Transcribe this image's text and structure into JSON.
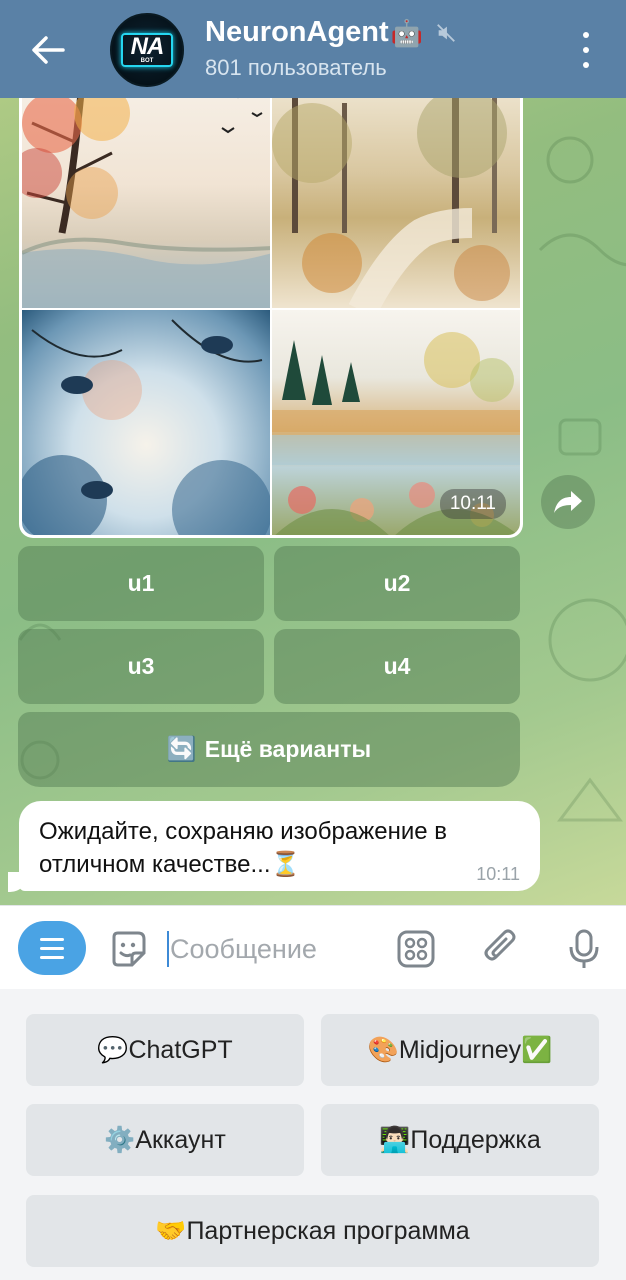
{
  "header": {
    "title": "NeuronAgent",
    "subtitle": "801 пользователь",
    "avatar_text": "NA",
    "avatar_subtext": "BOT",
    "title_emoji": "🤖"
  },
  "image_message": {
    "time": "10:11"
  },
  "inline_buttons": {
    "u1": "u1",
    "u2": "u2",
    "u3": "u3",
    "u4": "u4",
    "more_emoji": "🔄",
    "more_label": "Ещё варианты"
  },
  "text_message": {
    "text": "Ожидайте, сохраняю изображение в отличном качестве...⏳",
    "time": "10:11"
  },
  "input": {
    "placeholder": "Сообщение"
  },
  "keyboard": {
    "chatgpt": "💬ChatGPT",
    "midjourney": "🎨Midjourney✅",
    "account": "⚙️Аккаунт",
    "support": "👨🏻‍💻Поддержка",
    "partner": "🤝Партнерская программа"
  },
  "colors": {
    "header_bg": "#5a81a6",
    "accent": "#4aa3e4",
    "chat_bg": "#93bd7f"
  }
}
